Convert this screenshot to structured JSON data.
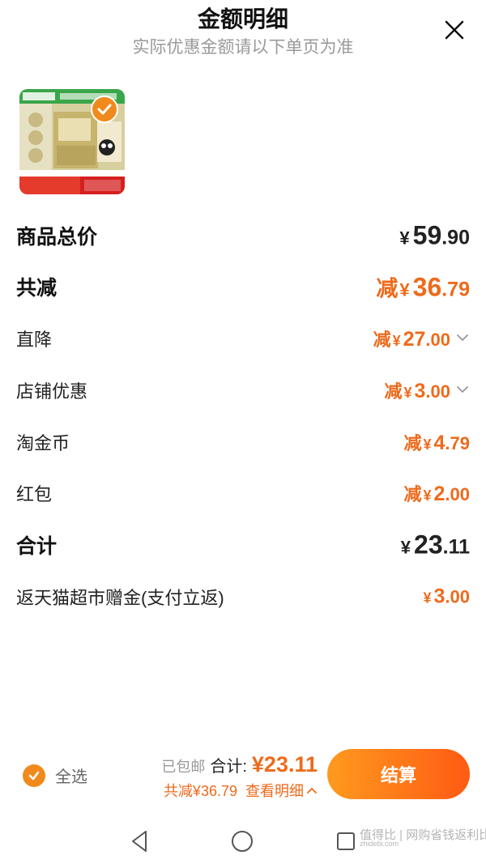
{
  "header": {
    "title": "金额明细",
    "subtitle": "实际优惠金额请以下单页为准"
  },
  "rows": [
    {
      "label": "商品总价",
      "prefix": "",
      "yen": "¥",
      "int": "59",
      "dec": ".90",
      "color": "dark"
    },
    {
      "label": "共减",
      "prefix": "减",
      "yen": "¥",
      "int": "36",
      "dec": ".79",
      "color": "orange"
    },
    {
      "label": "直降",
      "prefix": "减",
      "yen": "¥",
      "int": "27",
      "dec": ".00",
      "color": "orange",
      "chevron": true
    },
    {
      "label": "店铺优惠",
      "prefix": "减",
      "yen": "¥",
      "int": "3",
      "dec": ".00",
      "color": "orange",
      "chevron": true
    },
    {
      "label": "淘金币",
      "prefix": "减",
      "yen": "¥",
      "int": "4",
      "dec": ".79",
      "color": "orange"
    },
    {
      "label": "红包",
      "prefix": "减",
      "yen": "¥",
      "int": "2",
      "dec": ".00",
      "color": "orange"
    },
    {
      "label": "合计",
      "prefix": "",
      "yen": "¥",
      "int": "23",
      "dec": ".11",
      "color": "dark"
    },
    {
      "label": "返天猫超市赠金(支付立返)",
      "prefix": "",
      "yen": "¥",
      "int": "3",
      "dec": ".00",
      "color": "orange"
    }
  ],
  "footer": {
    "select_all": "全选",
    "free_shipping": "已包邮",
    "total_label": "合计:",
    "total_value": "¥23.11",
    "reduced_text": "共减¥36.79",
    "view_detail": "查看明细",
    "pay_button": "结算"
  },
  "watermark": {
    "text": "值得比 | 网购省钱返利比",
    "domain": "zhidebi.com"
  },
  "colors": {
    "accent": "#ee6a1b",
    "button_start": "#ff9a1e",
    "button_end": "#ff5a13"
  }
}
